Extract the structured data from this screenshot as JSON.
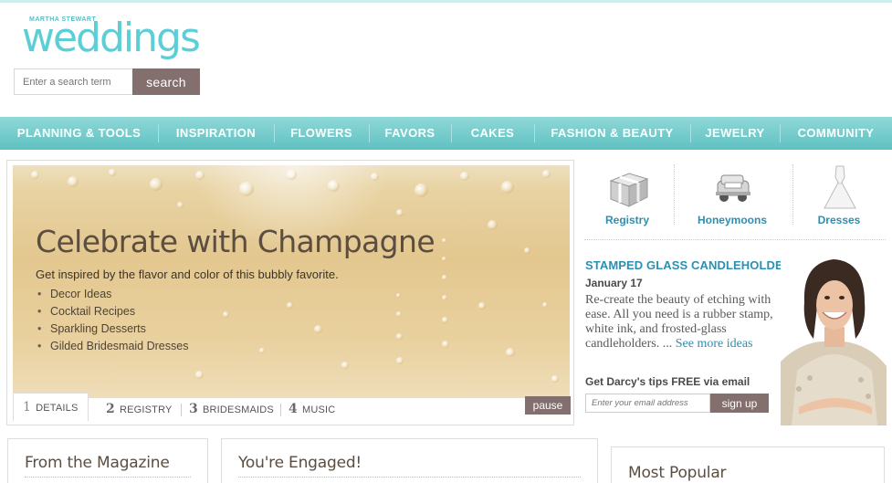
{
  "header": {
    "brand_small": "MARTHA STEWART",
    "logo_word": "weddings",
    "search_placeholder": "Enter a search term",
    "search_button": "search"
  },
  "nav": {
    "items": [
      "PLANNING & TOOLS",
      "INSPIRATION",
      "FLOWERS",
      "FAVORS",
      "CAKES",
      "FASHION & BEAUTY",
      "JEWELRY",
      "COMMUNITY"
    ]
  },
  "slideshow": {
    "title": "Celebrate with Champagne",
    "subtitle": "Get inspired by the flavor and color of this bubbly favorite.",
    "list": [
      "Decor Ideas",
      "Cocktail Recipes",
      "Sparkling Desserts",
      "Gilded Bridesmaid Dresses"
    ],
    "tabs": [
      {
        "num": "1",
        "label": "DETAILS"
      },
      {
        "num": "2",
        "label": "REGISTRY"
      },
      {
        "num": "3",
        "label": "BRIDESMAIDS"
      },
      {
        "num": "4",
        "label": "MUSIC"
      }
    ],
    "pause_label": "pause"
  },
  "quick_links": [
    "Registry",
    "Honeymoons",
    "Dresses"
  ],
  "feature": {
    "title": "STAMPED GLASS CANDLEHOLDERS",
    "date": "January 17",
    "description": "Re-create the beauty of etching with ease. All you need is a rubber stamp, white ink, and frosted-glass candleholders. ...",
    "more_link": "See more ideas",
    "tips_label": "Get Darcy's tips FREE via email",
    "email_placeholder": "Enter your email address",
    "signup_label": "sign up"
  },
  "sections": {
    "magazine": "From the Magazine",
    "engaged": "You're Engaged!",
    "popular": "Most Popular"
  },
  "colors": {
    "brand_teal": "#5ccfd6",
    "nav_teal": "#5fc1c1",
    "link_blue": "#2d8fb1",
    "button_mauve": "#846f6f"
  }
}
